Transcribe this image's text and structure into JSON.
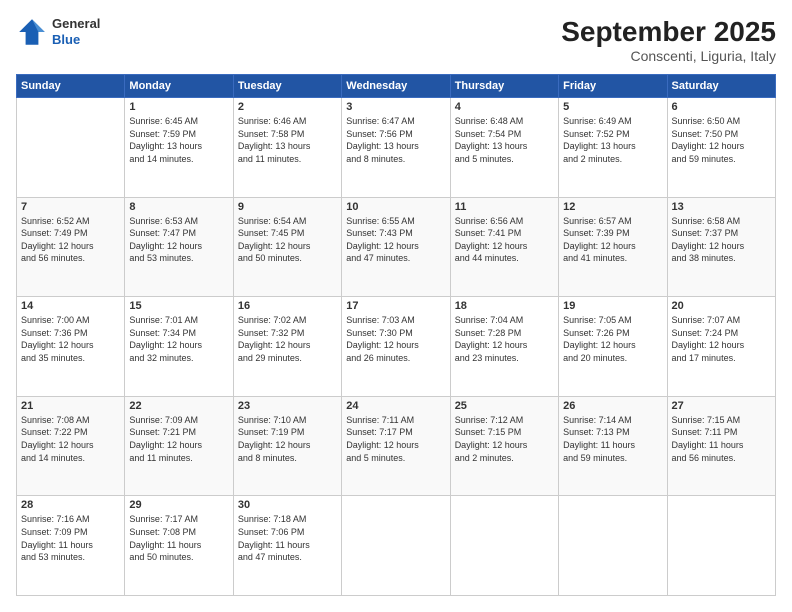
{
  "header": {
    "logo_general": "General",
    "logo_blue": "Blue",
    "month_title": "September 2025",
    "location": "Conscenti, Liguria, Italy"
  },
  "days_of_week": [
    "Sunday",
    "Monday",
    "Tuesday",
    "Wednesday",
    "Thursday",
    "Friday",
    "Saturday"
  ],
  "weeks": [
    [
      {
        "day": "",
        "info": ""
      },
      {
        "day": "1",
        "info": "Sunrise: 6:45 AM\nSunset: 7:59 PM\nDaylight: 13 hours\nand 14 minutes."
      },
      {
        "day": "2",
        "info": "Sunrise: 6:46 AM\nSunset: 7:58 PM\nDaylight: 13 hours\nand 11 minutes."
      },
      {
        "day": "3",
        "info": "Sunrise: 6:47 AM\nSunset: 7:56 PM\nDaylight: 13 hours\nand 8 minutes."
      },
      {
        "day": "4",
        "info": "Sunrise: 6:48 AM\nSunset: 7:54 PM\nDaylight: 13 hours\nand 5 minutes."
      },
      {
        "day": "5",
        "info": "Sunrise: 6:49 AM\nSunset: 7:52 PM\nDaylight: 13 hours\nand 2 minutes."
      },
      {
        "day": "6",
        "info": "Sunrise: 6:50 AM\nSunset: 7:50 PM\nDaylight: 12 hours\nand 59 minutes."
      }
    ],
    [
      {
        "day": "7",
        "info": "Sunrise: 6:52 AM\nSunset: 7:49 PM\nDaylight: 12 hours\nand 56 minutes."
      },
      {
        "day": "8",
        "info": "Sunrise: 6:53 AM\nSunset: 7:47 PM\nDaylight: 12 hours\nand 53 minutes."
      },
      {
        "day": "9",
        "info": "Sunrise: 6:54 AM\nSunset: 7:45 PM\nDaylight: 12 hours\nand 50 minutes."
      },
      {
        "day": "10",
        "info": "Sunrise: 6:55 AM\nSunset: 7:43 PM\nDaylight: 12 hours\nand 47 minutes."
      },
      {
        "day": "11",
        "info": "Sunrise: 6:56 AM\nSunset: 7:41 PM\nDaylight: 12 hours\nand 44 minutes."
      },
      {
        "day": "12",
        "info": "Sunrise: 6:57 AM\nSunset: 7:39 PM\nDaylight: 12 hours\nand 41 minutes."
      },
      {
        "day": "13",
        "info": "Sunrise: 6:58 AM\nSunset: 7:37 PM\nDaylight: 12 hours\nand 38 minutes."
      }
    ],
    [
      {
        "day": "14",
        "info": "Sunrise: 7:00 AM\nSunset: 7:36 PM\nDaylight: 12 hours\nand 35 minutes."
      },
      {
        "day": "15",
        "info": "Sunrise: 7:01 AM\nSunset: 7:34 PM\nDaylight: 12 hours\nand 32 minutes."
      },
      {
        "day": "16",
        "info": "Sunrise: 7:02 AM\nSunset: 7:32 PM\nDaylight: 12 hours\nand 29 minutes."
      },
      {
        "day": "17",
        "info": "Sunrise: 7:03 AM\nSunset: 7:30 PM\nDaylight: 12 hours\nand 26 minutes."
      },
      {
        "day": "18",
        "info": "Sunrise: 7:04 AM\nSunset: 7:28 PM\nDaylight: 12 hours\nand 23 minutes."
      },
      {
        "day": "19",
        "info": "Sunrise: 7:05 AM\nSunset: 7:26 PM\nDaylight: 12 hours\nand 20 minutes."
      },
      {
        "day": "20",
        "info": "Sunrise: 7:07 AM\nSunset: 7:24 PM\nDaylight: 12 hours\nand 17 minutes."
      }
    ],
    [
      {
        "day": "21",
        "info": "Sunrise: 7:08 AM\nSunset: 7:22 PM\nDaylight: 12 hours\nand 14 minutes."
      },
      {
        "day": "22",
        "info": "Sunrise: 7:09 AM\nSunset: 7:21 PM\nDaylight: 12 hours\nand 11 minutes."
      },
      {
        "day": "23",
        "info": "Sunrise: 7:10 AM\nSunset: 7:19 PM\nDaylight: 12 hours\nand 8 minutes."
      },
      {
        "day": "24",
        "info": "Sunrise: 7:11 AM\nSunset: 7:17 PM\nDaylight: 12 hours\nand 5 minutes."
      },
      {
        "day": "25",
        "info": "Sunrise: 7:12 AM\nSunset: 7:15 PM\nDaylight: 12 hours\nand 2 minutes."
      },
      {
        "day": "26",
        "info": "Sunrise: 7:14 AM\nSunset: 7:13 PM\nDaylight: 11 hours\nand 59 minutes."
      },
      {
        "day": "27",
        "info": "Sunrise: 7:15 AM\nSunset: 7:11 PM\nDaylight: 11 hours\nand 56 minutes."
      }
    ],
    [
      {
        "day": "28",
        "info": "Sunrise: 7:16 AM\nSunset: 7:09 PM\nDaylight: 11 hours\nand 53 minutes."
      },
      {
        "day": "29",
        "info": "Sunrise: 7:17 AM\nSunset: 7:08 PM\nDaylight: 11 hours\nand 50 minutes."
      },
      {
        "day": "30",
        "info": "Sunrise: 7:18 AM\nSunset: 7:06 PM\nDaylight: 11 hours\nand 47 minutes."
      },
      {
        "day": "",
        "info": ""
      },
      {
        "day": "",
        "info": ""
      },
      {
        "day": "",
        "info": ""
      },
      {
        "day": "",
        "info": ""
      }
    ]
  ]
}
